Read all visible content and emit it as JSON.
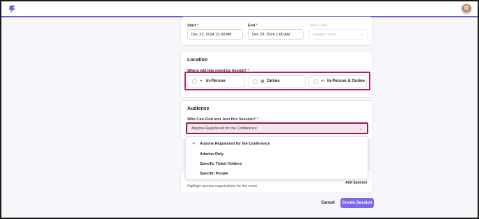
{
  "header": {
    "logo_icon": "bolt-logo-icon",
    "avatar_icon": "user-avatar-icon"
  },
  "schedule": {
    "start_label": "Start",
    "start_value": "Dec 23, 2024 12:00 AM",
    "end_label": "End",
    "end_value": "Dec 23, 2024 1:00 AM",
    "timezone_label": "Time Zone",
    "timezone_value": "Eastern Time"
  },
  "location": {
    "title": "Location",
    "question": "Where will this event be hosted?",
    "options": [
      {
        "label": "In-Person",
        "icon": "map-pin-icon"
      },
      {
        "label": "Online",
        "icon": "globe-icon"
      },
      {
        "label": "In-Person & Online",
        "icon": "link-icon"
      }
    ]
  },
  "audience": {
    "title": "Audience",
    "question": "Who Can Find and Join this Session?",
    "selected": "Anyone Registered for the Conference",
    "options": [
      {
        "label": "Anyone Registered for the Conference",
        "checked": true
      },
      {
        "label": "Admins Only",
        "checked": false
      },
      {
        "label": "Specific Ticket Holders",
        "checked": false
      },
      {
        "label": "Specific People",
        "checked": false
      }
    ]
  },
  "sponsors": {
    "description": "Highlight sponsor organizations for this event.",
    "add_label": "Add Sponsor"
  },
  "footer": {
    "cancel_label": "Cancel",
    "create_label": "Create Session"
  },
  "required_mark": "*",
  "colors": {
    "accent": "#7b68ee",
    "highlight": "#c2185b"
  }
}
